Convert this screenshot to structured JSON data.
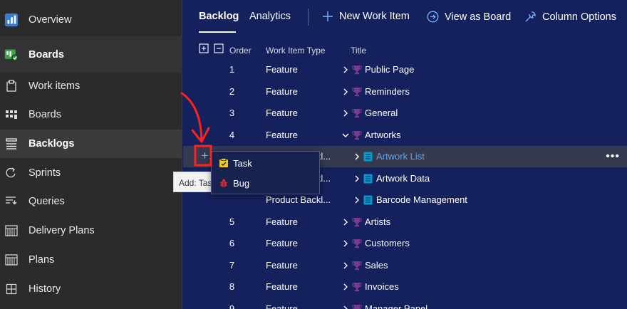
{
  "sidebar": {
    "items": [
      {
        "label": "Overview",
        "icon": "overview-icon"
      },
      {
        "label": "Boards",
        "icon": "boards-hub-icon"
      },
      {
        "label": "Work items",
        "icon": "work-items-icon"
      },
      {
        "label": "Boards",
        "icon": "boards-icon"
      },
      {
        "label": "Backlogs",
        "icon": "backlogs-icon"
      },
      {
        "label": "Sprints",
        "icon": "sprints-icon"
      },
      {
        "label": "Queries",
        "icon": "queries-icon"
      },
      {
        "label": "Delivery Plans",
        "icon": "delivery-plans-icon"
      },
      {
        "label": "Plans",
        "icon": "plans-icon"
      },
      {
        "label": "History",
        "icon": "history-icon"
      }
    ],
    "selected": "Backlogs"
  },
  "toolbar": {
    "tab_backlog": "Backlog",
    "tab_analytics": "Analytics",
    "new_work_item": "New Work Item",
    "view_as_board": "View as Board",
    "column_options": "Column Options"
  },
  "columns": {
    "order": "Order",
    "type": "Work Item Type",
    "title": "Title"
  },
  "rows": [
    {
      "order": "1",
      "type": "Feature",
      "title": "Public Page",
      "expanded": false
    },
    {
      "order": "2",
      "type": "Feature",
      "title": "Reminders",
      "expanded": false
    },
    {
      "order": "3",
      "type": "Feature",
      "title": "General",
      "expanded": false
    },
    {
      "order": "4",
      "type": "Feature",
      "title": "Artworks",
      "expanded": true
    },
    {
      "order": "",
      "type": "Product Backl...",
      "title": "Artwork List",
      "expanded": false
    },
    {
      "order": "",
      "type": "Product Backl...",
      "title": "Artwork Data",
      "expanded": false
    },
    {
      "order": "",
      "type": "Product Backl...",
      "title": "Barcode Management",
      "expanded": false
    },
    {
      "order": "5",
      "type": "Feature",
      "title": "Artists",
      "expanded": false
    },
    {
      "order": "6",
      "type": "Feature",
      "title": "Customers",
      "expanded": false
    },
    {
      "order": "7",
      "type": "Feature",
      "title": "Sales",
      "expanded": false
    },
    {
      "order": "8",
      "type": "Feature",
      "title": "Invoices",
      "expanded": false
    },
    {
      "order": "9",
      "type": "Feature",
      "title": "Manager Panel",
      "expanded": false
    }
  ],
  "popup": {
    "items": [
      {
        "label": "Task",
        "icon": "task-icon",
        "color": "#f2cb1d"
      },
      {
        "label": "Bug",
        "icon": "bug-icon",
        "color": "#cc293d"
      }
    ]
  },
  "tooltip": "Add: Task",
  "more_label": "•••",
  "colors": {
    "main_bg": "#15215c",
    "sidebar_bg": "#2b2b2b",
    "feature_icon": "#773b93",
    "pbi_icon": "#009ccc",
    "link_blue": "#5fa4ea",
    "annotation_red": "#ff2020"
  }
}
